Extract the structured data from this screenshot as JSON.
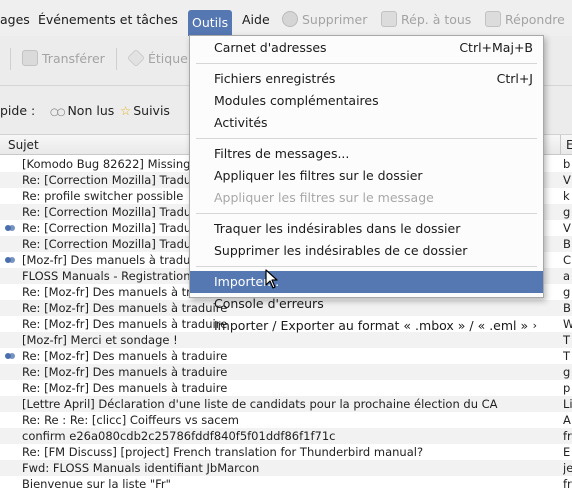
{
  "menubar": {
    "items": [
      {
        "label": "ages",
        "state": "normal"
      },
      {
        "label": "Événements et tâches",
        "state": "normal"
      },
      {
        "label": "Outils",
        "state": "active"
      },
      {
        "label": "Aide",
        "state": "normal"
      },
      {
        "label": "Supprimer",
        "state": "disabled",
        "icon": "delete-icon"
      },
      {
        "label": "Rép. à tous",
        "state": "disabled",
        "icon": "reply-all-icon"
      },
      {
        "label": "Répondre",
        "state": "disabled",
        "icon": "reply-icon"
      }
    ]
  },
  "toolbar": {
    "forward_label": "Transférer",
    "tag_label": "Étique"
  },
  "quickfilter": {
    "prefix": "pide :",
    "unread_label": "Non lus",
    "starred_label": "Suivis"
  },
  "thread_list": {
    "subject_header": "Sujet",
    "extra_header": "E",
    "rows": [
      {
        "subject": "[Komodo Bug 82622] Missing",
        "col2": "b",
        "thread_icon": false
      },
      {
        "subject": "Re: [Correction Mozilla] Traduction",
        "col2": "V",
        "thread_icon": false
      },
      {
        "subject": "Re: profile switcher possible",
        "col2": "k",
        "thread_icon": false
      },
      {
        "subject": "Re: [Correction Mozilla] Traduction",
        "col2": "g",
        "thread_icon": false
      },
      {
        "subject": "Re: [Correction Mozilla] Traduction",
        "col2": "V",
        "thread_icon": true
      },
      {
        "subject": "Re: [Correction Mozilla] Traduction",
        "col2": "B",
        "thread_icon": false
      },
      {
        "subject": "[Moz-fr] Des manuels à traduire",
        "col2": "C",
        "thread_icon": true
      },
      {
        "subject": "FLOSS Manuals - Registration",
        "col2": "a",
        "thread_icon": false
      },
      {
        "subject": "Re: [Moz-fr] Des manuels à traduire",
        "col2": "g",
        "thread_icon": false
      },
      {
        "subject": "Re: [Moz-fr] Des manuels à traduire",
        "col2": "B",
        "thread_icon": false
      },
      {
        "subject": "Re: [Moz-fr] Des manuels à traduire",
        "col2": "W",
        "thread_icon": false
      },
      {
        "subject": "[Moz-fr] Merci et sondage !",
        "col2": "T",
        "thread_icon": false
      },
      {
        "subject": "Re: [Moz-fr] Des manuels à traduire",
        "col2": "T",
        "thread_icon": true
      },
      {
        "subject": "Re: [Moz-fr] Des manuels à traduire",
        "col2": "g",
        "thread_icon": false
      },
      {
        "subject": "Re: [Moz-fr] Des manuels à traduire",
        "col2": "p",
        "thread_icon": false
      },
      {
        "subject": "[Lettre April] Déclaration d'une liste de candidats pour la prochaine élection du CA",
        "col2": "Li",
        "thread_icon": false
      },
      {
        "subject": "Re: Re : Re: [clicc] Coiffeurs vs sacem",
        "col2": "A",
        "thread_icon": false
      },
      {
        "subject": "confirm e26a080cdb2c25786fddf840f5f01ddf86f1f71c",
        "col2": "fr",
        "thread_icon": false
      },
      {
        "subject": "Re: [FM Discuss] [project] French translation for Thunderbird manual?",
        "col2": "E",
        "thread_icon": false
      },
      {
        "subject": "Fwd: FLOSS Manuals identifiant JbMarcon",
        "col2": "je",
        "thread_icon": false
      },
      {
        "subject": "Bienvenue sur la liste \"Fr\"",
        "col2": "fr",
        "thread_icon": false
      }
    ]
  },
  "menu": {
    "items": [
      {
        "label": "Carnet d'adresses",
        "shortcut": "Ctrl+Maj+B",
        "state": "normal"
      },
      {
        "sep": true
      },
      {
        "label": "Fichiers enregistrés",
        "shortcut": "Ctrl+J",
        "state": "normal"
      },
      {
        "label": "Modules complémentaires",
        "shortcut": "",
        "state": "normal"
      },
      {
        "label": "Activités",
        "shortcut": "",
        "state": "normal"
      },
      {
        "sep": true
      },
      {
        "label": "Filtres de messages...",
        "shortcut": "",
        "state": "normal"
      },
      {
        "label": "Appliquer les filtres sur le dossier",
        "shortcut": "",
        "state": "normal"
      },
      {
        "label": "Appliquer les filtres sur le message",
        "shortcut": "",
        "state": "disabled"
      },
      {
        "sep": true
      },
      {
        "label": "Traquer les indésirables dans le dossier",
        "shortcut": "",
        "state": "normal"
      },
      {
        "label": "Supprimer les indésirables de ce dossier",
        "shortcut": "",
        "state": "normal"
      },
      {
        "sep": true
      },
      {
        "label": "Importer...",
        "shortcut": "",
        "state": "highlight"
      },
      {
        "label": "Console d'erreurs",
        "shortcut": "",
        "state": "normal"
      },
      {
        "label": "Importer / Exporter au format « .mbox » / « .eml »",
        "shortcut": "",
        "state": "normal",
        "submenu": true
      }
    ]
  },
  "colors": {
    "highlight": "#5578b3",
    "disabled_text": "#a8a8a8",
    "thread_icon": "#4a6fae",
    "star": "#e8b520"
  }
}
